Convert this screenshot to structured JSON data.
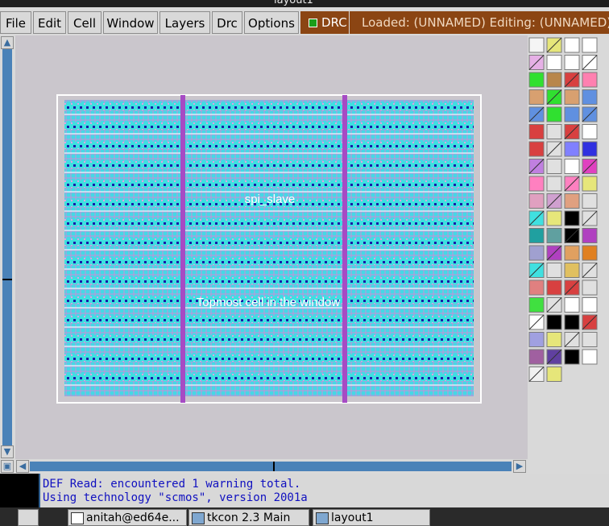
{
  "window": {
    "title": "layout1"
  },
  "menubar": {
    "items": [
      {
        "id": "file",
        "label": "File"
      },
      {
        "id": "edit",
        "label": "Edit"
      },
      {
        "id": "cell",
        "label": "Cell"
      },
      {
        "id": "window",
        "label": "Window"
      },
      {
        "id": "layers",
        "label": "Layers"
      },
      {
        "id": "drc",
        "label": "Drc"
      },
      {
        "id": "options",
        "label": "Options"
      }
    ],
    "drc_button": {
      "label": "DRC",
      "indicator_color": "#1a9e1a"
    },
    "status": "Loaded: (UNNAMED) Editing: (UNNAMED)"
  },
  "layout": {
    "cell_label": "spi_slave",
    "window_label": "Topmost cell in the window"
  },
  "console": {
    "lines": [
      "DEF Read: encountered 1 warning total.",
      "Using technology \"scmos\", version 2001a"
    ]
  },
  "taskbar": {
    "tasks": [
      {
        "label": "anitah@ed64e..."
      },
      {
        "label": "tkcon 2.3 Main"
      },
      {
        "label": "layout1"
      }
    ]
  },
  "colors": {
    "metal": "#3ee0e0",
    "poly": "#a64bc4",
    "accent": "#8b4513",
    "scrollbar": "#4a82b8",
    "console_text": "#1010c0"
  }
}
